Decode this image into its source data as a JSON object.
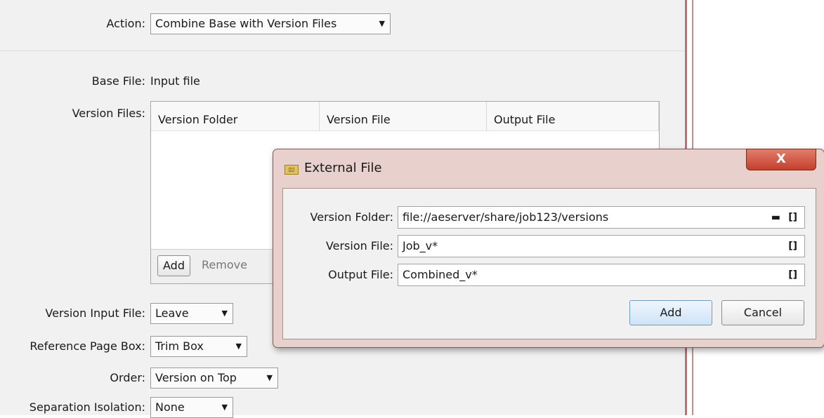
{
  "form": {
    "action": {
      "label": "Action:",
      "value": "Combine Base with Version Files"
    },
    "base_file": {
      "label": "Base File:",
      "value": "Input file"
    },
    "version_files": {
      "label": "Version Files:",
      "columns": [
        "Version Folder",
        "Version File",
        "Output File"
      ],
      "add_label": "Add",
      "remove_label": "Remove"
    },
    "version_input_file": {
      "label": "Version Input File:",
      "value": "Leave"
    },
    "reference_page_box": {
      "label": "Reference Page Box:",
      "value": "Trim Box"
    },
    "order": {
      "label": "Order:",
      "value": "Version on Top"
    },
    "separation_isolation": {
      "label": "Separation Isolation:",
      "value": "None"
    }
  },
  "dialog": {
    "title": "External File",
    "close_label": "X",
    "fields": [
      {
        "label": "Version Folder:",
        "value": "file://aeserver/share/job123/versions"
      },
      {
        "label": "Version File:",
        "value": "Job_v*"
      },
      {
        "label": "Output File:",
        "value": "Combined_v*"
      }
    ],
    "add_label": "Add",
    "cancel_label": "Cancel"
  },
  "icons": {
    "dropdown": "triangle-down",
    "folder": "folder-icon",
    "variable": "brackets-icon"
  }
}
